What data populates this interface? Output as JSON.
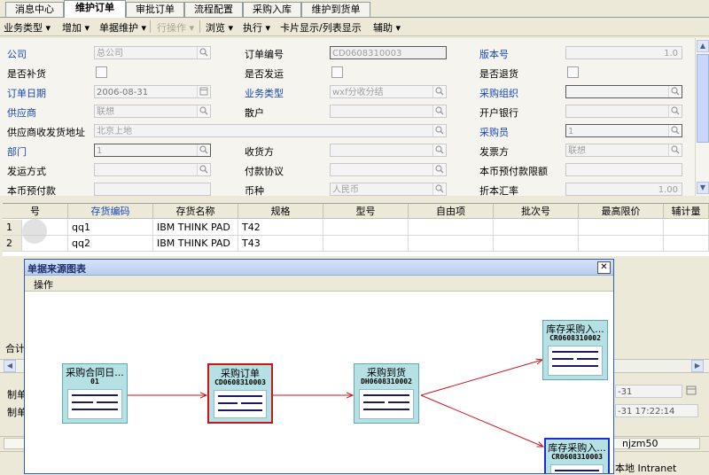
{
  "tabs": [
    "消息中心",
    "维护订单",
    "审批订单",
    "流程配置",
    "采购入库",
    "维护到货单"
  ],
  "active_tab": "维护订单",
  "menu": {
    "items": [
      "业务类型 ▾",
      "增加 ▾",
      "单据维护 ▾",
      "行操作 ▾",
      "浏览 ▾",
      "执行 ▾",
      "卡片显示/列表显示",
      "辅助 ▾"
    ]
  },
  "form": {
    "company_label": "公司",
    "company_value": "总公司",
    "order_no_label": "订单编号",
    "order_no_value": "CD0608310003",
    "version_label": "版本号",
    "version_value": "1.0",
    "replenish_label": "是否补货",
    "shipped_label": "是否发运",
    "return_label": "是否退货",
    "order_date_label": "订单日期",
    "order_date_value": "2006-08-31",
    "biz_type_label": "业务类型",
    "biz_type_value": "wxf分收分结",
    "purchase_org_label": "采购组织",
    "purchase_org_value": "",
    "supplier_label": "供应商",
    "supplier_value": "联想",
    "retail_label": "散户",
    "bank_label": "开户银行",
    "ship_addr_label": "供应商收发货地址",
    "ship_addr_value": "北京上地",
    "buyer_label": "采购员",
    "buyer_value": "1",
    "dept_label": "部门",
    "dept_value": "1",
    "consignee_label": "收货方",
    "invoice_label": "发票方",
    "invoice_value": "联想",
    "ship_method_label": "发运方式",
    "payment_label": "付款协议",
    "prepay_limit_label": "本币预付款限额",
    "prepay_label": "本币预付款",
    "currency_label": "币种",
    "currency_value": "人民币",
    "rate_label": "折本汇率",
    "rate_value": "1.00"
  },
  "grid": {
    "headers": [
      "号",
      "存货编码",
      "存货名称",
      "规格",
      "型号",
      "自由项",
      "批次号",
      "最高限价",
      "辅计量"
    ],
    "rows": [
      {
        "no": "1",
        "code": "qq1",
        "name": "IBM THINK PAD",
        "spec": "T42"
      },
      {
        "no": "2",
        "code": "qq2",
        "name": "IBM THINK PAD",
        "spec": "T43"
      }
    ]
  },
  "dialog": {
    "title": "单据来源图表",
    "menu": "操作",
    "close": "✕",
    "nodes": [
      {
        "title": "采购合同日...",
        "code": "01"
      },
      {
        "title": "采购订单",
        "code": "CD0608310003"
      },
      {
        "title": "采购到货",
        "code": "DH0608310002"
      },
      {
        "title": "库存采购入...",
        "code": "CR0608310002"
      },
      {
        "title": "库存采购入...",
        "code": "CR0608310003"
      }
    ]
  },
  "lower": {
    "total_label": "合计",
    "maker_label": "制单",
    "maker2_label": "制单",
    "date1": "-31",
    "date2": "-31 17:22:14",
    "user": "njzm50",
    "zone": "本地 Intranet"
  },
  "colors": {
    "accent": "#1847b6",
    "red": "#c8161d",
    "node": "#b5e0e4"
  }
}
